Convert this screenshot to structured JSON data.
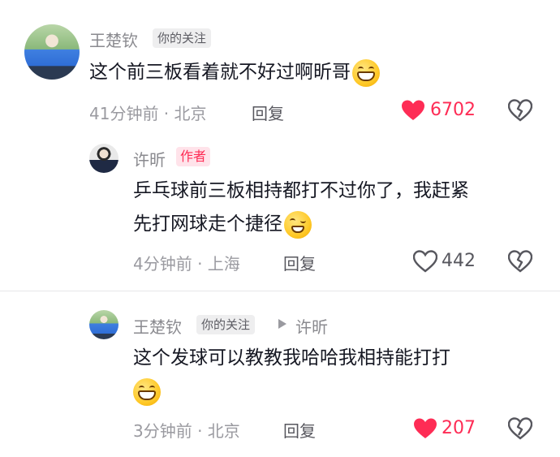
{
  "comments": [
    {
      "author": "王楚钦",
      "badge": "你的关注",
      "text": "这个前三板看着就不好过啊昕哥",
      "time_loc": "41分钟前 · 北京",
      "reply_label": "回复",
      "likes": "6702",
      "liked": true,
      "emoji": "grin-emoji"
    },
    {
      "author": "许昕",
      "badge": "作者",
      "text_line1": "乒乓球前三板相持都打不过你了，我赶紧",
      "text_line2": "先打网球走个捷径",
      "time_loc": "4分钟前 · 上海",
      "reply_label": "回复",
      "likes": "442",
      "liked": false,
      "emoji": "wink-emoji"
    },
    {
      "author": "王楚钦",
      "badge": "你的关注",
      "reply_to": "许昕",
      "text": "这个发球可以教教我哈哈我相持能打打",
      "time_loc": "3分钟前 · 北京",
      "reply_label": "回复",
      "likes": "207",
      "liked": true,
      "emoji": "grin-emoji"
    }
  ],
  "colors": {
    "like_red": "#fe2c55",
    "meta_grey": "#9a9aa0"
  }
}
